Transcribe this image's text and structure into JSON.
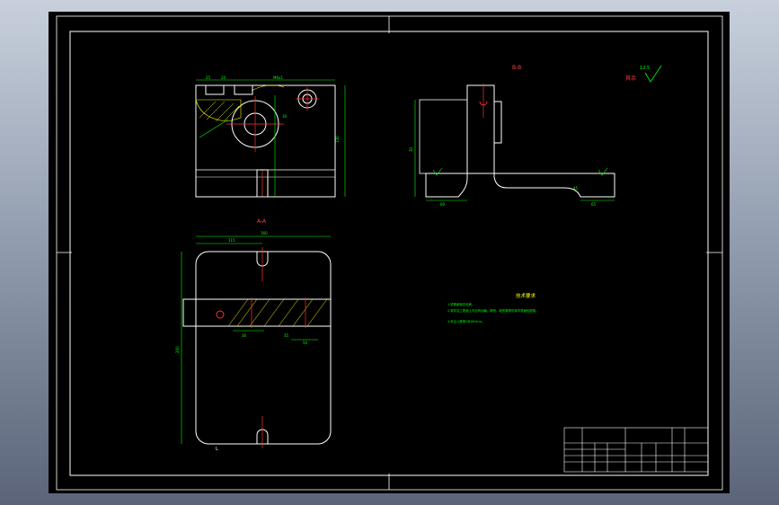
{
  "drawing": {
    "section_bb": "B-B",
    "section_aa": "A-A",
    "roughness_note": "其余",
    "roughness_value": "12.5",
    "tech_title": "技术要求",
    "tech_lines": [
      "1.锐角倒钝去毛刺。",
      "2.零件加工表面上不应有划痕、擦伤、碰伤等损伤零件表面的缺陷。",
      "3.未注公差按GB1804-m。"
    ],
    "dims_top": [
      "25",
      "20",
      "M6x1",
      "16",
      "130"
    ],
    "dims_aa": [
      "160",
      "115",
      "200",
      "30",
      "35",
      "50"
    ],
    "dims_bb": [
      "30",
      "60",
      "65",
      "45"
    ],
    "label_l": "L"
  },
  "colors": {
    "background": "#000000",
    "line": "#ffffff",
    "dimension": "#00ff00",
    "center": "#ff0000",
    "hatch": "#ffff00"
  }
}
